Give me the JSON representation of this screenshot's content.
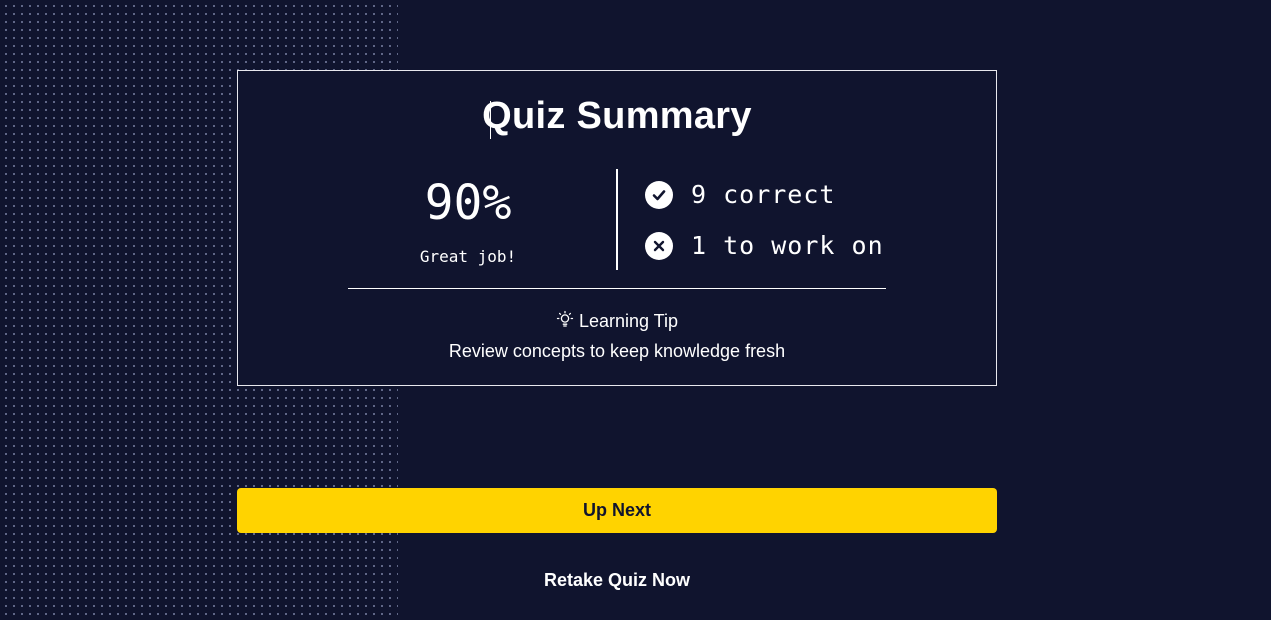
{
  "summary": {
    "title": "Quiz Summary",
    "score": "90%",
    "score_message": "Great job!",
    "correct_text": "9 correct",
    "wrong_text": "1 to work on",
    "correct_icon": "check-circle-icon",
    "wrong_icon": "x-circle-icon"
  },
  "tip": {
    "icon": "lightbulb-icon",
    "heading": "Learning Tip",
    "body": "Review concepts to keep knowledge fresh"
  },
  "actions": {
    "up_next_label": "Up Next",
    "retake_label": "Retake Quiz Now"
  },
  "colors": {
    "background": "#10142e",
    "accent": "#ffd300",
    "text": "#ffffff"
  }
}
